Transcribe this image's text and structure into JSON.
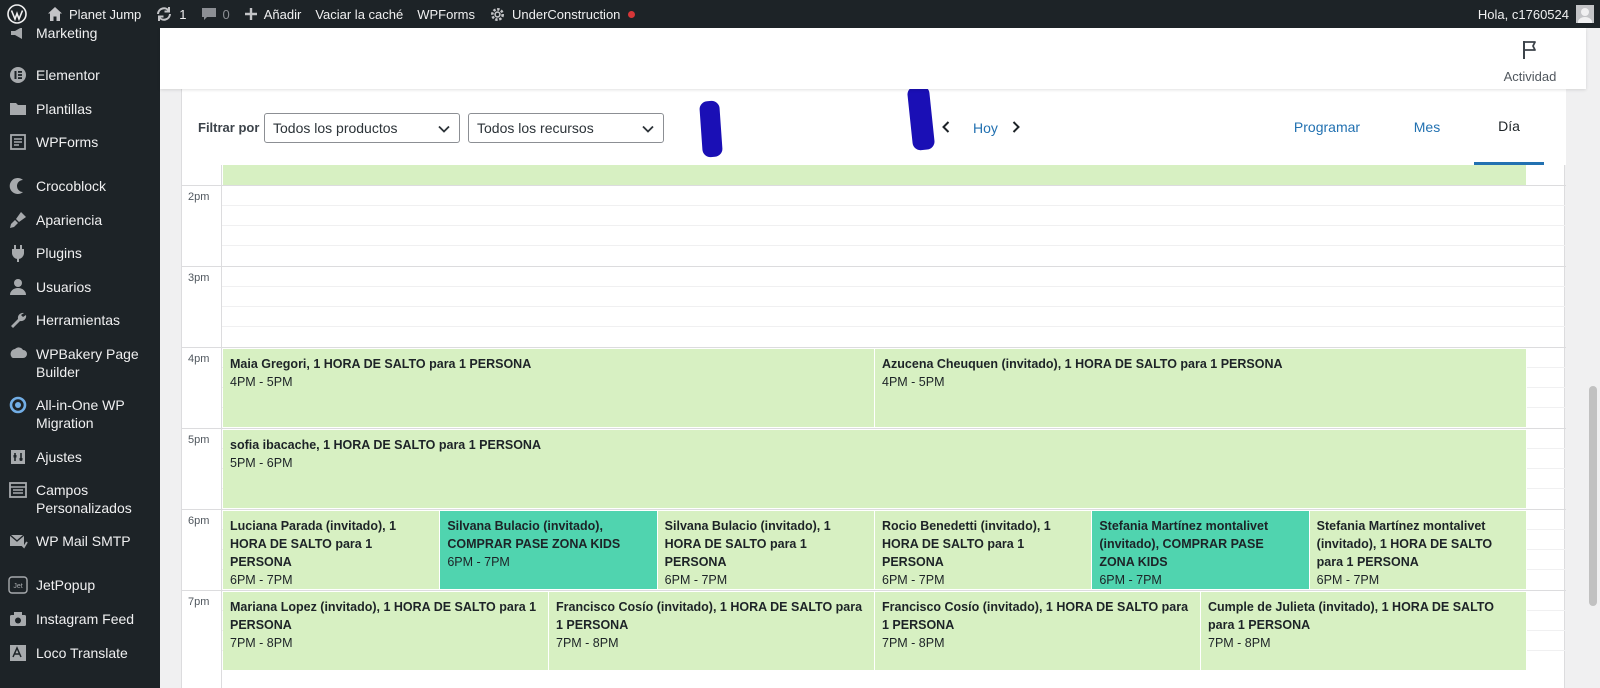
{
  "adminbar": {
    "site_name": "Planet Jump",
    "updates_count": "1",
    "comments_count": "0",
    "new_label": "Añadir",
    "cache_label": "Vaciar la caché",
    "wpforms_label": "WPForms",
    "underconstruction_label": "UnderConstruction",
    "greeting": "Hola, c1760524"
  },
  "sidebar": {
    "items": [
      {
        "label": "Marketing",
        "icon": "megaphone-icon"
      },
      {
        "label": "Elementor",
        "icon": "elementor-icon"
      },
      {
        "label": "Plantillas",
        "icon": "folder-icon"
      },
      {
        "label": "WPForms",
        "icon": "forms-icon"
      },
      {
        "label": "Crocoblock",
        "icon": "crocoblock-icon"
      },
      {
        "label": "Apariencia",
        "icon": "paintbrush-icon"
      },
      {
        "label": "Plugins",
        "icon": "plug-icon"
      },
      {
        "label": "Usuarios",
        "icon": "user-icon"
      },
      {
        "label": "Herramientas",
        "icon": "wrench-icon"
      },
      {
        "label": "WPBakery Page Builder",
        "icon": "wpbakery-icon"
      },
      {
        "label": "All-in-One WP Migration",
        "icon": "migration-icon"
      },
      {
        "label": "Ajustes",
        "icon": "settings-icon"
      },
      {
        "label": "Campos Personalizados",
        "icon": "fields-icon"
      },
      {
        "label": "WP Mail SMTP",
        "icon": "mail-icon"
      },
      {
        "label": "JetPopup",
        "icon": "jetpopup-icon"
      },
      {
        "label": "Instagram Feed",
        "icon": "camera-icon"
      },
      {
        "label": "Loco Translate",
        "icon": "translate-icon"
      }
    ]
  },
  "header": {
    "activity_label": "Actividad"
  },
  "toolbar": {
    "filter_label": "Filtrar por",
    "products_select": "Todos los productos",
    "resources_select": "Todos los recursos",
    "today_label": "Hoy",
    "tabs": [
      "Programar",
      "Mes",
      "Día"
    ],
    "active_tab": "Día"
  },
  "calendar": {
    "hours": [
      "2pm",
      "3pm",
      "4pm",
      "5pm",
      "6pm",
      "7pm"
    ],
    "events": [
      {
        "title": "Maia Gregori, 1 HORA DE SALTO para 1 PERSONA",
        "time": "4PM - 5PM",
        "hour": "4pm",
        "col": 0,
        "span": 3,
        "cols": 6,
        "kind": "booking"
      },
      {
        "title": "Azucena Cheuquen (invitado), 1 HORA DE SALTO para 1 PERSONA",
        "time": "4PM - 5PM",
        "hour": "4pm",
        "col": 3,
        "span": 3,
        "cols": 6,
        "kind": "booking"
      },
      {
        "title": "sofia ibacache, 1 HORA DE SALTO para 1 PERSONA",
        "time": "5PM - 6PM",
        "hour": "5pm",
        "col": 0,
        "span": 6,
        "cols": 6,
        "kind": "booking"
      },
      {
        "title": "Luciana Parada (invitado), 1 HORA DE SALTO para 1 PERSONA",
        "time": "6PM - 7PM",
        "hour": "6pm",
        "col": 0,
        "span": 1,
        "cols": 6,
        "kind": "booking"
      },
      {
        "title": "Silvana Bulacio (invitado), COMPRAR PASE ZONA KIDS",
        "time": "6PM - 7PM",
        "hour": "6pm",
        "col": 1,
        "span": 1,
        "cols": 6,
        "kind": "kids"
      },
      {
        "title": "Silvana Bulacio (invitado), 1 HORA DE SALTO para 1 PERSONA",
        "time": "6PM - 7PM",
        "hour": "6pm",
        "col": 2,
        "span": 1,
        "cols": 6,
        "kind": "booking"
      },
      {
        "title": "Rocio Benedetti (invitado), 1 HORA DE SALTO para 1 PERSONA",
        "time": "6PM - 7PM",
        "hour": "6pm",
        "col": 3,
        "span": 1,
        "cols": 6,
        "kind": "booking"
      },
      {
        "title": "Stefania Martínez montalivet (invitado), COMPRAR PASE ZONA KIDS",
        "time": "6PM - 7PM",
        "hour": "6pm",
        "col": 4,
        "span": 1,
        "cols": 6,
        "kind": "kids"
      },
      {
        "title": "Stefania Martínez montalivet (invitado), 1 HORA DE SALTO para 1 PERSONA",
        "time": "6PM - 7PM",
        "hour": "6pm",
        "col": 5,
        "span": 1,
        "cols": 6,
        "kind": "booking"
      },
      {
        "title": "Mariana Lopez (invitado), 1 HORA DE SALTO para 1 PERSONA",
        "time": "7PM - 8PM",
        "hour": "7pm",
        "col": 0,
        "span": 1,
        "cols": 4,
        "kind": "booking"
      },
      {
        "title": "Francisco Cosío (invitado), 1 HORA DE SALTO para 1 PERSONA",
        "time": "7PM - 8PM",
        "hour": "7pm",
        "col": 1,
        "span": 1,
        "cols": 4,
        "kind": "booking"
      },
      {
        "title": "Francisco Cosío (invitado), 1 HORA DE SALTO para 1 PERSONA",
        "time": "7PM - 8PM",
        "hour": "7pm",
        "col": 2,
        "span": 1,
        "cols": 4,
        "kind": "booking"
      },
      {
        "title": "Cumple de Julieta (invitado), 1 HORA DE SALTO para 1 PERSONA",
        "time": "7PM - 8PM",
        "hour": "7pm",
        "col": 3,
        "span": 1,
        "cols": 4,
        "kind": "booking"
      }
    ]
  },
  "colors": {
    "admin_dark": "#1d2327",
    "accent": "#2271b1",
    "booking_green": "#d7f0c2",
    "kids_teal": "#50d4af",
    "scribble": "#1a0fb5"
  }
}
